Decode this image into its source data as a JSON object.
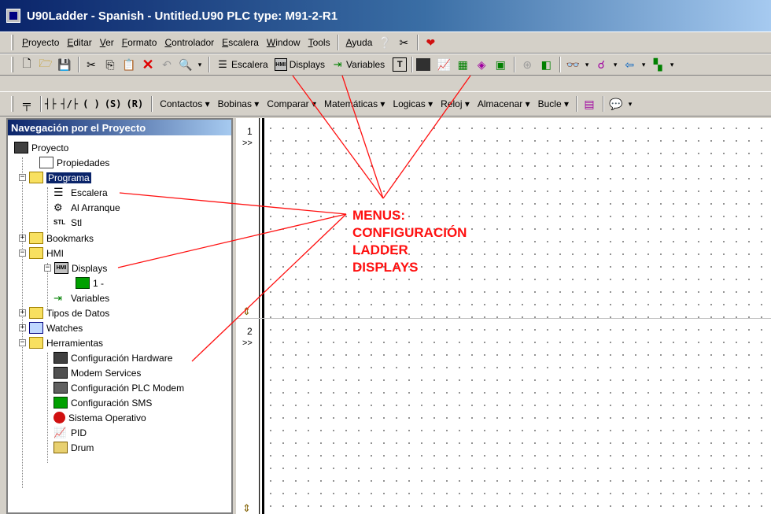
{
  "window": {
    "title": "U90Ladder - Spanish - Untitled.U90   PLC type: M91-2-R1"
  },
  "menubar": {
    "items": [
      "Proyecto",
      "Editar",
      "Ver",
      "Formato",
      "Controlador",
      "Escalera",
      "Window",
      "Tools",
      "Ayuda"
    ]
  },
  "toolbar1": {
    "escalera": "Escalera",
    "displays": "Displays",
    "variables": "Variables"
  },
  "toolbar2": {
    "symbols": [
      "┤├",
      "┤/├",
      "( )",
      "(S)",
      "(R)"
    ],
    "menus": [
      "Contactos",
      "Bobinas",
      "Comparar",
      "Matemáticas",
      "Logicas",
      "Reloj",
      "Almacenar",
      "Bucle"
    ]
  },
  "nav": {
    "header": "Navegación por el Proyecto",
    "items": [
      {
        "label": "Proyecto",
        "icon": "project-icon"
      },
      {
        "label": "Propiedades",
        "icon": "properties-icon"
      },
      {
        "label": "Programa",
        "icon": "folder-icon"
      },
      {
        "label": "Escalera",
        "icon": "ladder-icon"
      },
      {
        "label": "Al Arranque",
        "icon": "startup-icon"
      },
      {
        "label": "Stl",
        "icon": "stl-icon"
      },
      {
        "label": "Bookmarks",
        "icon": "folder-icon"
      },
      {
        "label": "HMI",
        "icon": "folder-icon"
      },
      {
        "label": "Displays",
        "icon": "hmi-icon"
      },
      {
        "label": "1 -",
        "icon": "display-icon"
      },
      {
        "label": "Variables",
        "icon": "variables-icon"
      },
      {
        "label": "Tipos de Datos",
        "icon": "folder-icon"
      },
      {
        "label": "Watches",
        "icon": "watches-icon"
      },
      {
        "label": "Herramientas",
        "icon": "folder-icon"
      },
      {
        "label": "Configuración Hardware",
        "icon": "hardware-icon"
      },
      {
        "label": "Modem Services",
        "icon": "modem-icon"
      },
      {
        "label": "Configuración PLC Modem",
        "icon": "plc-modem-icon"
      },
      {
        "label": "Configuración SMS",
        "icon": "sms-icon"
      },
      {
        "label": "Sistema Operativo",
        "icon": "os-icon"
      },
      {
        "label": "PID",
        "icon": "pid-icon"
      },
      {
        "label": "Drum",
        "icon": "drum-icon"
      }
    ]
  },
  "rungs": [
    {
      "number": "1",
      "marker": ">>"
    },
    {
      "number": "2",
      "marker": ">>"
    }
  ],
  "annotation": {
    "lines": [
      "MENUS:",
      "CONFIGURACIÓN",
      "LADDER",
      "DISPLAYS"
    ],
    "color": "#ff1010"
  }
}
